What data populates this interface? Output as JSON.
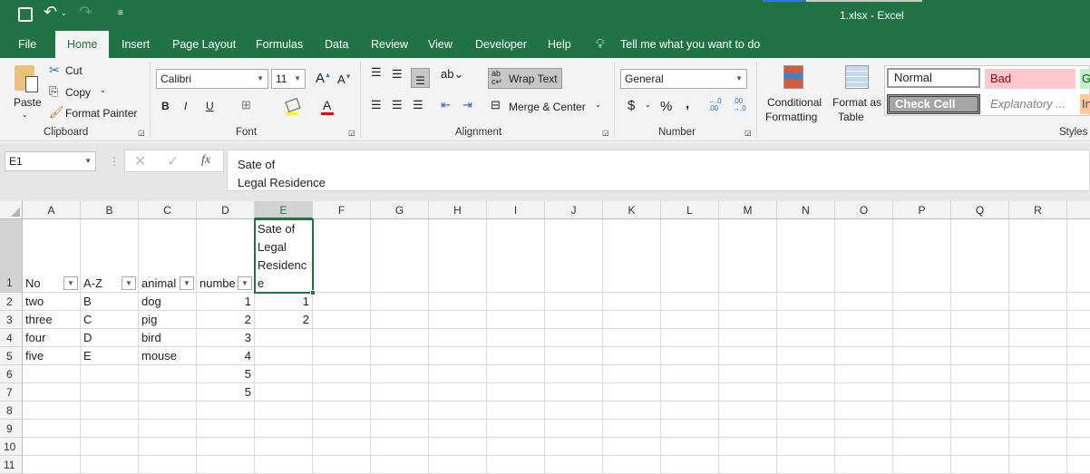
{
  "window": {
    "title": "1.xlsx  -  Excel"
  },
  "tabs": [
    "File",
    "Home",
    "Insert",
    "Page Layout",
    "Formulas",
    "Data",
    "Review",
    "View",
    "Developer",
    "Help"
  ],
  "tell_me": "Tell me what you want to do",
  "clipboard": {
    "paste": "Paste",
    "cut": "Cut",
    "copy": "Copy",
    "format_painter": "Format Painter",
    "label": "Clipboard"
  },
  "font": {
    "name": "Calibri",
    "size": "11",
    "label": "Font",
    "bold": "B",
    "italic": "I",
    "underline": "U"
  },
  "alignment": {
    "wrap_text": "Wrap Text",
    "merge_center": "Merge & Center",
    "label": "Alignment"
  },
  "number": {
    "format": "General",
    "currency": "$",
    "percent": "%",
    "comma": ",",
    "label": "Number"
  },
  "styles": {
    "conditional": "Conditional",
    "formatting": "Formatting",
    "format_as": "Format as",
    "table": "Table",
    "label": "Styles",
    "cells": {
      "normal": "Normal",
      "bad": "Bad",
      "good": "G",
      "check_cell": "Check Cell",
      "explanatory": "Explanatory ...",
      "input": "In"
    }
  },
  "formula_bar": {
    "name_box": "E1",
    "fx": "fx",
    "line1": "Sate of",
    "line2": "Legal Residence"
  },
  "columns": [
    "A",
    "B",
    "C",
    "D",
    "E",
    "F",
    "G",
    "H",
    "I",
    "J",
    "K",
    "L",
    "M",
    "N",
    "O",
    "P",
    "Q",
    "R"
  ],
  "rows": [
    "1",
    "2",
    "3",
    "4",
    "5",
    "6",
    "7",
    "8",
    "9",
    "10",
    "11"
  ],
  "cells": {
    "A1": "No",
    "B1": "A-Z",
    "C1": "animal",
    "D1": "numbe",
    "E1a": "Sate of",
    "E1b": "Legal",
    "E1c": "Residenc",
    "E1d": "e",
    "A2": "two",
    "B2": "B",
    "C2": "dog",
    "D2": "1",
    "E2": "1",
    "A3": "three",
    "B3": "C",
    "C3": "pig",
    "D3": "2",
    "E3": "2",
    "A4": "four",
    "B4": "D",
    "C4": "bird",
    "D4": "3",
    "A5": "five",
    "B5": "E",
    "C5": "mouse",
    "D5": "4",
    "D6": "5",
    "D7": "5"
  },
  "colors": {
    "accent": "#217346"
  }
}
